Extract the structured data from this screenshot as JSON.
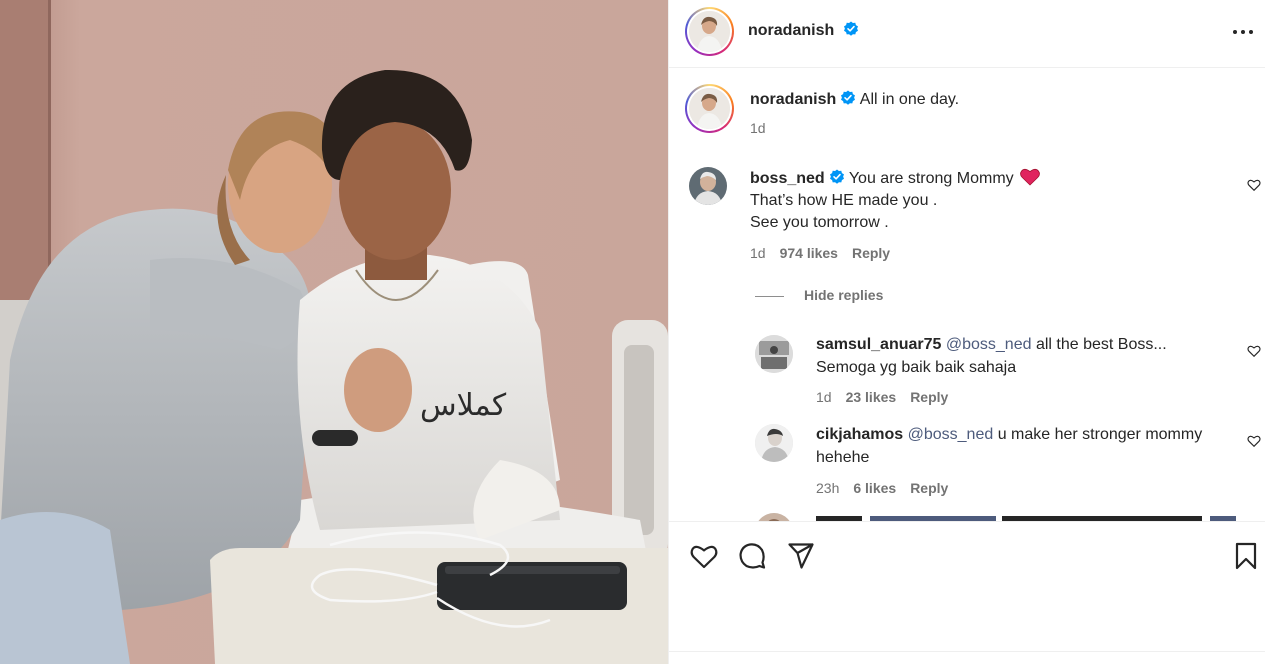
{
  "post": {
    "author": "noradanish",
    "author_verified": true,
    "caption": "All in one day.",
    "time": "1d",
    "photo_text": "كملاس"
  },
  "comments": [
    {
      "user": "boss_ned",
      "verified": true,
      "lines": [
        "You are strong Mommy",
        "That’s how HE made you .",
        "See you tomorrow ."
      ],
      "emoji": "red-heart",
      "time": "1d",
      "likes": "974 likes",
      "reply_label": "Reply"
    }
  ],
  "hide_replies_label": "Hide replies",
  "replies": [
    {
      "user": "samsul_anuar75",
      "mention": "@boss_ned",
      "text_after_mention": " all the best Boss...",
      "line2": "Semoga yg baik baik sahaja",
      "time": "1d",
      "likes": "23 likes",
      "reply_label": "Reply"
    },
    {
      "user": "cikjahamos",
      "mention": "@boss_ned",
      "text_after_mention": " u make her stronger mommy",
      "line2": "hehehe",
      "time": "23h",
      "likes": "6 likes",
      "reply_label": "Reply"
    }
  ],
  "icons": {
    "like": "heart-icon",
    "comment": "comment-icon",
    "share": "share-icon",
    "save": "bookmark-icon",
    "more": "more-icon",
    "verified": "verified-badge-icon"
  },
  "colors": {
    "verified": "#0095f6",
    "heart_emoji": "#e0245e",
    "text": "#262626",
    "muted": "#737373",
    "mention": "#4d5b7c",
    "divider": "#efefef"
  }
}
